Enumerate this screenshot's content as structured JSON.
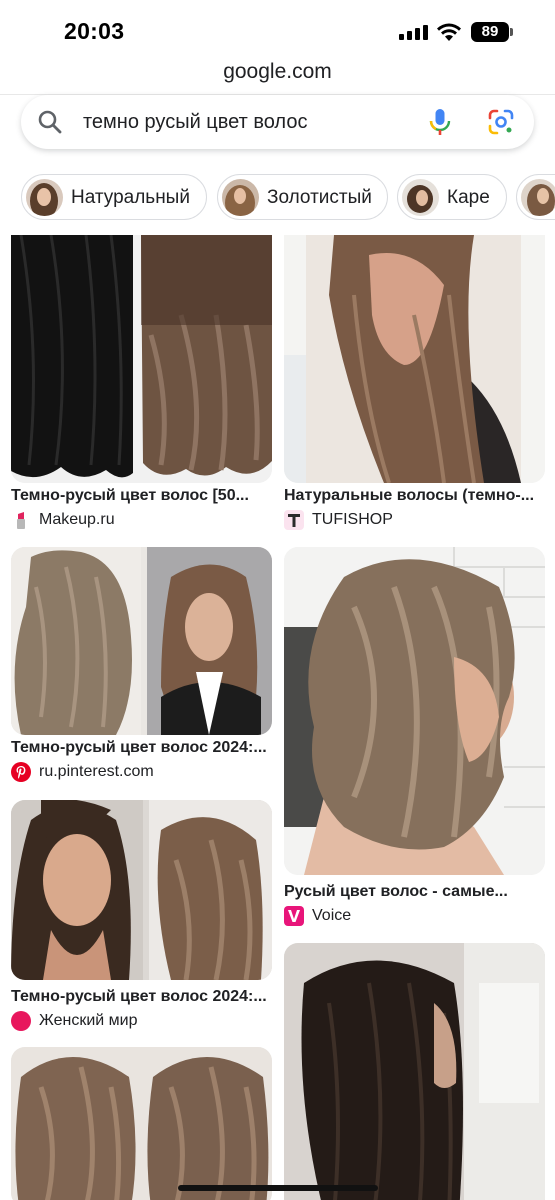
{
  "status_bar": {
    "time": "20:03",
    "battery": "89"
  },
  "browser": {
    "url": "google.com"
  },
  "search": {
    "query": "темно русый цвет волос"
  },
  "chips": [
    {
      "label": "Натуральный"
    },
    {
      "label": "Золотистый"
    },
    {
      "label": "Каре"
    }
  ],
  "results": [
    {
      "title": "Темно-русый цвет волос [50...",
      "source": "Makeup.ru",
      "source_icon": "lipstick-icon"
    },
    {
      "title": "Натуральные волосы (темно-...",
      "source": "TUFISHOP",
      "source_icon": "tufishop-logo-icon"
    },
    {
      "title": "Темно-русый цвет волос 2024:...",
      "source": "ru.pinterest.com",
      "source_icon": "pinterest-icon"
    },
    {
      "title": "Русый цвет волос - самые...",
      "source": "Voice",
      "source_icon": "voice-logo-icon"
    },
    {
      "title": "Темно-русый цвет волос 2024:...",
      "source": "Женский мир",
      "source_icon": "zhenskiy-mir-icon"
    }
  ],
  "colors": {
    "google_blue": "#4285F4",
    "google_red": "#EA4335",
    "google_yellow": "#FBBC05",
    "google_green": "#34A853",
    "pinterest": "#E60023",
    "voice": "#E8157A",
    "tufishop": "#E82C8C"
  }
}
